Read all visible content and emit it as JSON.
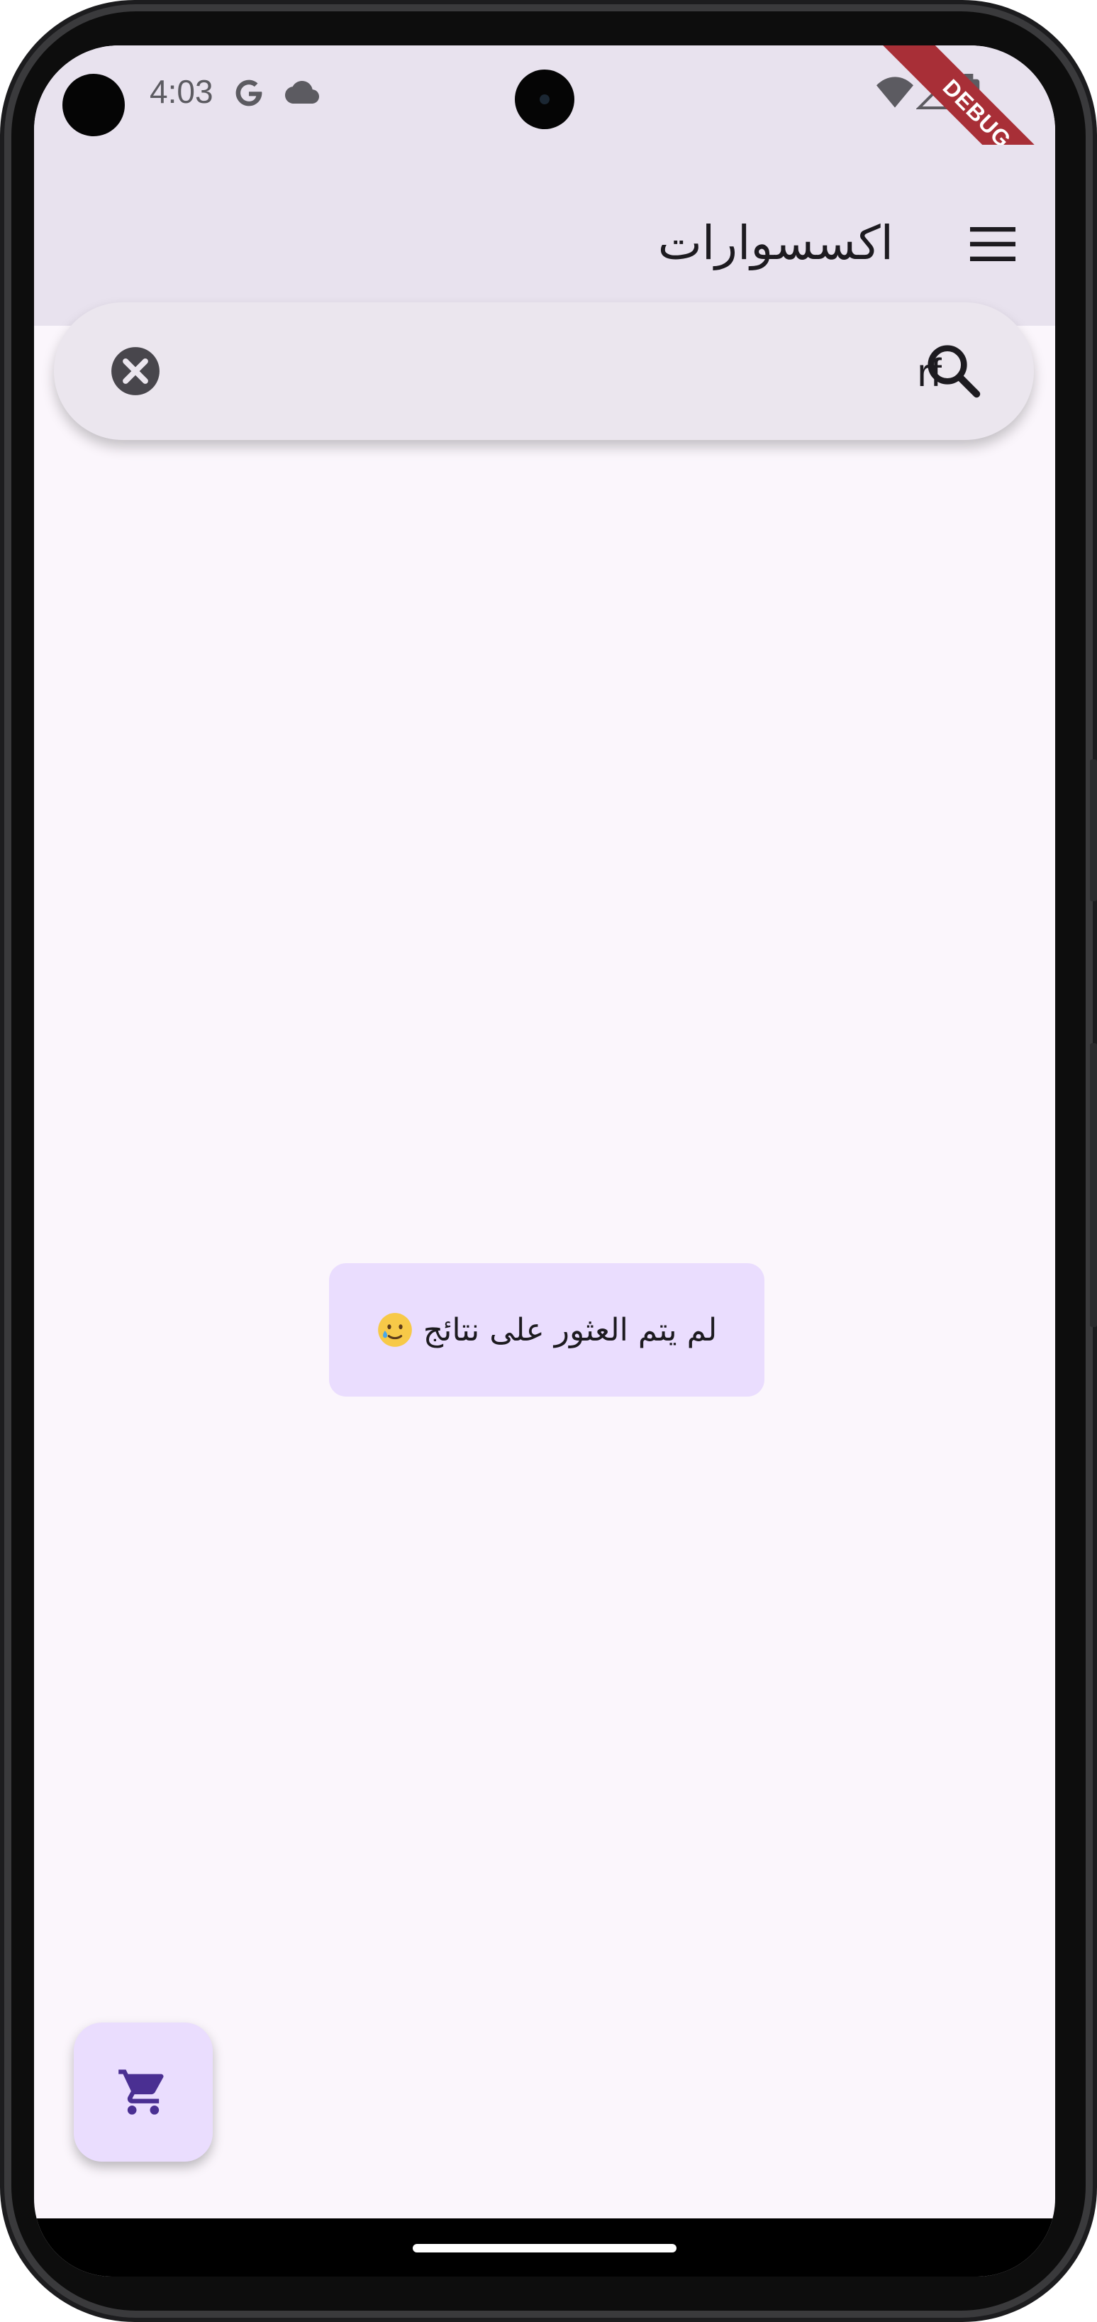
{
  "status_bar": {
    "time": "4:03",
    "icons": [
      "google-icon",
      "cloud-icon",
      "wifi-icon",
      "signal-icon",
      "battery-icon"
    ]
  },
  "debug_banner": "DEBUG",
  "app_bar": {
    "title": "اكسسوارات",
    "menu_icon": "hamburger-menu-icon"
  },
  "search": {
    "query": "rf",
    "clear_icon": "cancel-icon",
    "search_icon": "search-icon"
  },
  "empty_state": {
    "message": "لم يتم العثور على نتائج",
    "emoji_icon": "smiling-face-with-tear-icon"
  },
  "fab": {
    "icon": "shopping-cart-icon"
  },
  "colors": {
    "app_bar_bg": "#e8e2ee",
    "screen_bg": "#fbf6fc",
    "search_bg": "#ebe6ee",
    "container_bg": "#eaddfe",
    "fab_icon": "#4a2f92",
    "debug_ribbon": "#a82f37"
  }
}
